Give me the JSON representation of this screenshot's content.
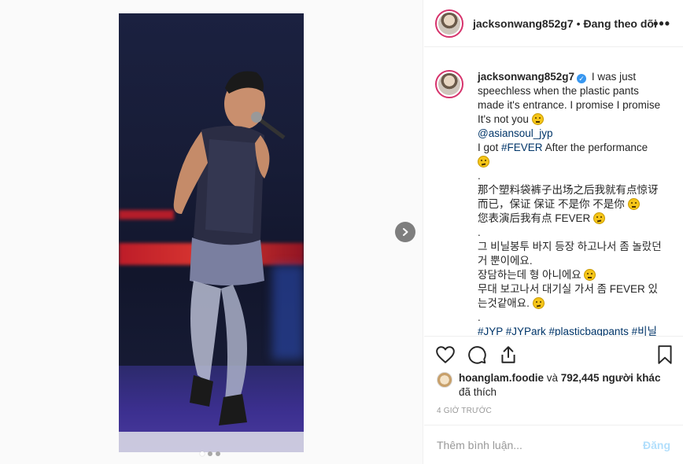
{
  "post": {
    "author": "jacksonwang852g7",
    "separator": "•",
    "follow_status": "Đang theo dõi",
    "more_label": "•••"
  },
  "caption": {
    "username": "jacksonwang852g7",
    "line1": "I was just speechless when the plastic pants made it's entrance. I promise I promise It's not you",
    "mention": "@asiansoul_jyp",
    "line2_pre": "I got ",
    "line2_tag": "#FEVER",
    "line2_post": " After the performance",
    "dot1": ".",
    "cn1": "那个塑料袋裤子出场之后我就有点惊讶而已，保证 保证 不是你 不是你",
    "cn2": "您表演后我有点 FEVER",
    "dot2": ".",
    "kr1": "그 비닐봉투 바지 등장 하고나서 좀 놀랐던거 뿐이에요.",
    "kr2": "장담하는데 형 아니에요",
    "kr3": "무대 보고나서 대기실 가서 좀 FEVER 있는것같애요.",
    "dot3": ".",
    "hashtags": "#JYP #JYPark #plasticbagpants #비닐"
  },
  "likes": {
    "first_user": "hoanglam.foodie",
    "connector": " và ",
    "count_text": "792,445 người khác",
    "suffix": "đã thích"
  },
  "timestamp": "4 GIỜ TRƯỚC",
  "comment": {
    "placeholder": "Thêm bình luận...",
    "post_label": "Đăng"
  },
  "carousel": {
    "total": 3,
    "active": 1
  },
  "icons": [
    "heart-icon",
    "comment-icon",
    "share-icon",
    "bookmark-icon",
    "chevron-right-icon",
    "verified-icon"
  ],
  "colors": {
    "accent_link": "#003569",
    "verified": "#3897f0",
    "post_disabled": "#b2dffc"
  }
}
